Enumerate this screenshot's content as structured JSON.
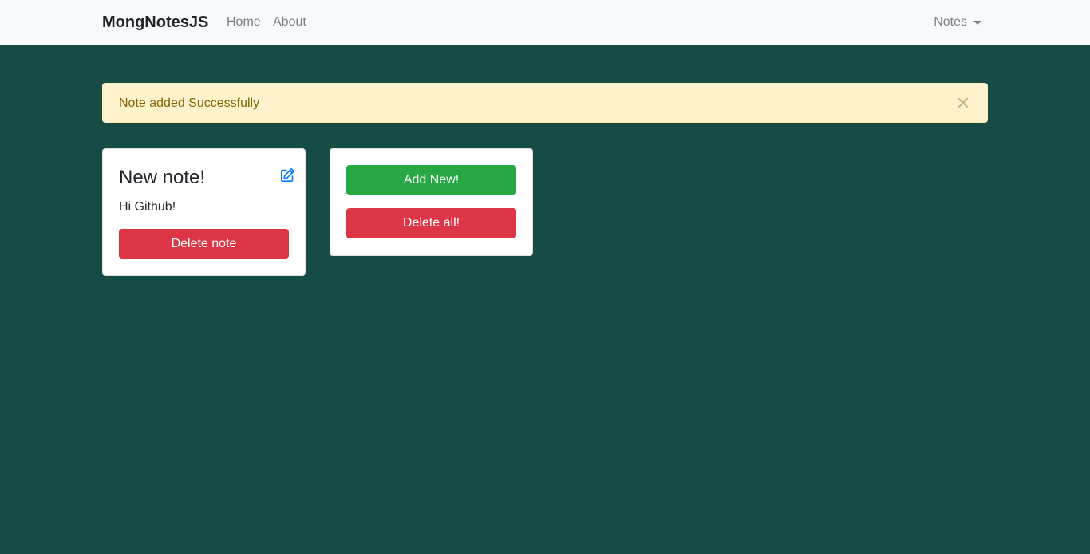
{
  "navbar": {
    "brand": "MongNotesJS",
    "links": [
      {
        "label": "Home"
      },
      {
        "label": "About"
      }
    ],
    "dropdown_label": "Notes"
  },
  "alert": {
    "message": "Note added Successfully",
    "close_icon": "close-icon"
  },
  "note": {
    "title": "New note!",
    "body": "Hi Github!",
    "edit_icon": "edit-icon",
    "delete_label": "Delete note"
  },
  "actions": {
    "add_label": "Add New!",
    "delete_all_label": "Delete all!"
  },
  "colors": {
    "page_background": "#174b45",
    "navbar_background": "#f8f9fa",
    "alert_background": "#fff3cd",
    "alert_text": "#856404",
    "success": "#28a745",
    "danger": "#dc3545",
    "edit_icon": "#007bff"
  }
}
